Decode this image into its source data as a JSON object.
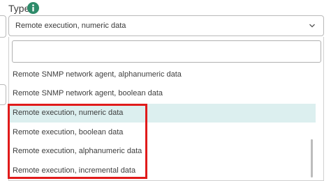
{
  "field": {
    "label": "Type",
    "info_icon": "info-icon",
    "selected_value": "Remote execution, numeric data"
  },
  "dropdown": {
    "search_value": "",
    "options": [
      {
        "label": "Remote SNMP network agent, alphanumeric data",
        "highlighted": false
      },
      {
        "label": "Remote SNMP network agent, boolean data",
        "highlighted": false
      },
      {
        "label": "Remote execution, numeric data",
        "highlighted": true
      },
      {
        "label": "Remote execution, boolean data",
        "highlighted": false
      },
      {
        "label": "Remote execution, alphanumeric data",
        "highlighted": false
      },
      {
        "label": "Remote execution, incremental data",
        "highlighted": false
      }
    ]
  },
  "colors": {
    "info_icon": "#2e8b6a",
    "highlight": "#dcefef",
    "annotation_box": "#e01b1b"
  }
}
